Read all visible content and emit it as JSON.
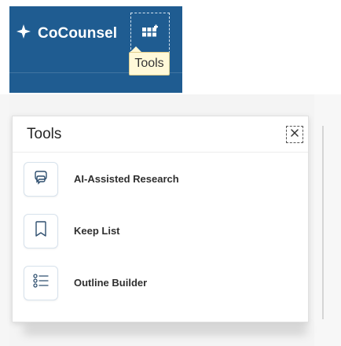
{
  "header": {
    "brand": "CoCounsel",
    "brand_icon": "sparkle-icon",
    "tools_button_icon": "grid-plus-icon",
    "tools_tooltip": "Tools",
    "brand_background": "#1f5c91"
  },
  "panel": {
    "title": "Tools",
    "close_icon": "close-icon",
    "items": [
      {
        "label": "AI-Assisted Research",
        "icon": "chat-bubbles-icon"
      },
      {
        "label": "Keep List",
        "icon": "bookmark-icon"
      },
      {
        "label": "Outline Builder",
        "icon": "list-icon"
      }
    ]
  },
  "colors": {
    "accent": "#1f5c91",
    "tooltip": "#fff9d9",
    "panel_border": "#e1e1e1"
  }
}
